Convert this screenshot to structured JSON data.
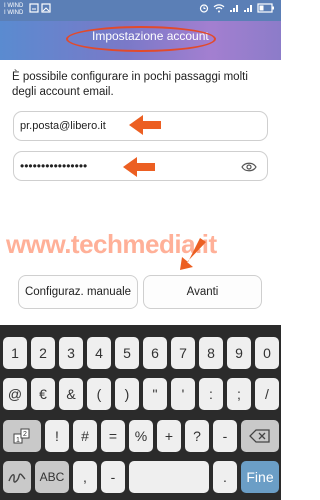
{
  "status_bar": {
    "carrier_1": "I WIND",
    "carrier_2": "I WIND"
  },
  "header": {
    "title": "Impostazione account"
  },
  "form": {
    "intro": "È possibile configurare in pochi passaggi molti degli account email.",
    "email_value": "pr.posta@libero.it",
    "password_mask": "••••••••••••••••"
  },
  "buttons": {
    "manual": "Configuraz. manuale",
    "next": "Avanti"
  },
  "watermark": "www.techmedia.it",
  "keyboard": {
    "row1": [
      "1",
      "2",
      "3",
      "4",
      "5",
      "6",
      "7",
      "8",
      "9",
      "0"
    ],
    "row2": [
      "@",
      "€",
      "&",
      "(",
      ")",
      "\"",
      "'",
      ":",
      ";",
      "/"
    ],
    "row3": [
      "!",
      "#",
      "=",
      "%",
      "+",
      "?",
      "-",
      "*"
    ],
    "row4": {
      "abc": "ABC",
      "comma": ",",
      "dash": "-",
      "dot": ".",
      "enter": "Fine"
    }
  },
  "colors": {
    "header_start": "#5a8bd0",
    "header_end": "#a37fd0",
    "annotation": "#ec5f22",
    "enter_key": "#6b9ec6"
  },
  "icons": [
    "sim-icon",
    "image-icon",
    "alarm-icon",
    "wifi-icon",
    "signal-icon",
    "battery-icon",
    "eye-icon",
    "shift-icon",
    "backspace-icon",
    "handwriting-icon",
    "arrow-icon"
  ]
}
